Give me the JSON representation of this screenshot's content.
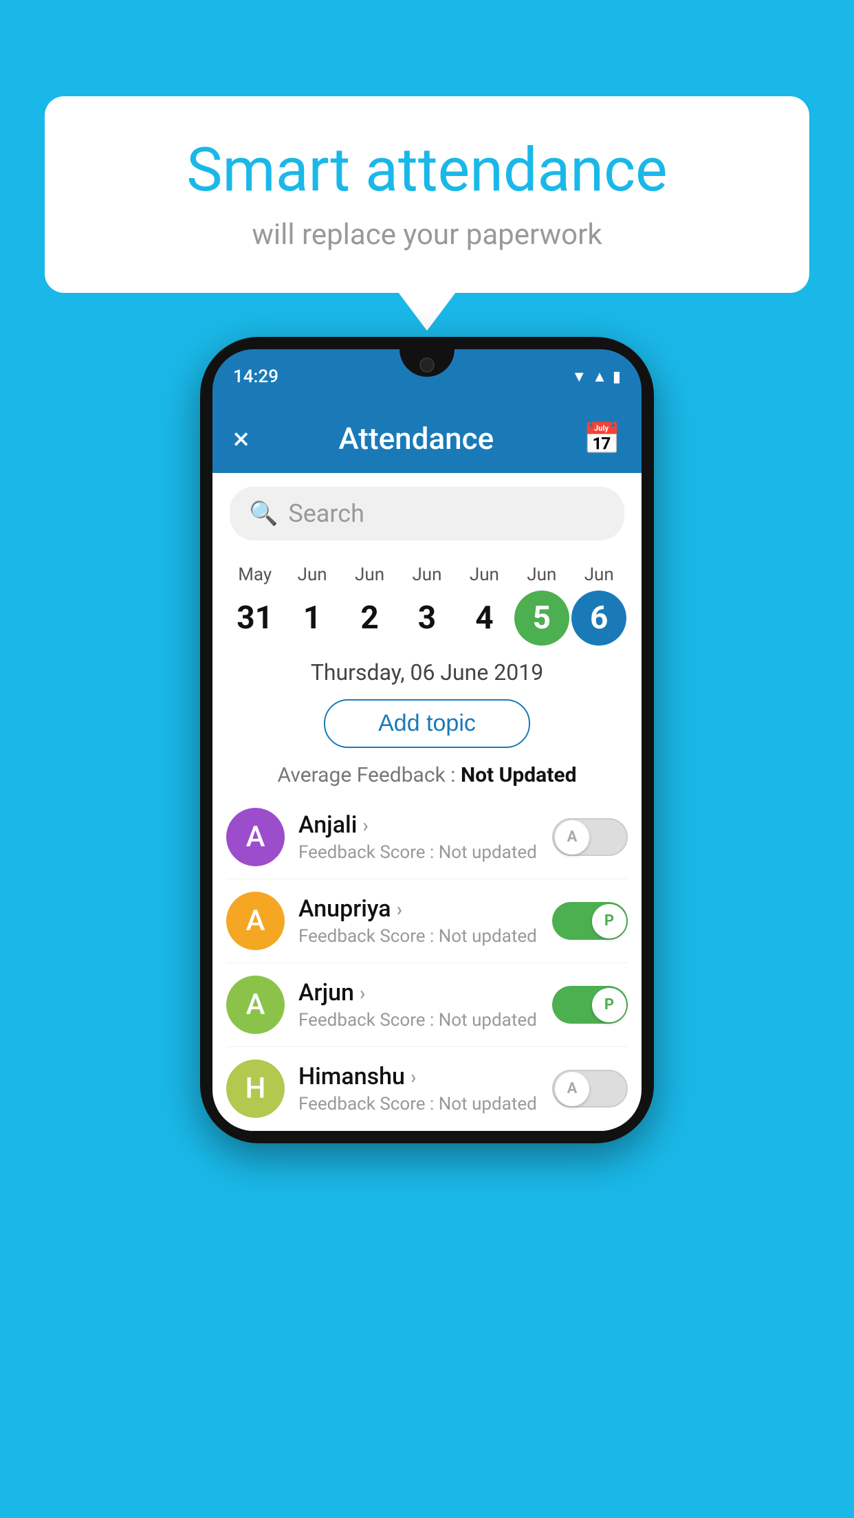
{
  "background": {
    "color": "#1ab8e8"
  },
  "speech_bubble": {
    "title": "Smart attendance",
    "subtitle": "will replace your paperwork"
  },
  "phone": {
    "status_bar": {
      "time": "14:29"
    },
    "app_bar": {
      "title": "Attendance",
      "close_label": "×",
      "calendar_label": "📅"
    },
    "search": {
      "placeholder": "Search"
    },
    "calendar": {
      "days": [
        {
          "month": "May",
          "num": "31",
          "state": "normal"
        },
        {
          "month": "Jun",
          "num": "1",
          "state": "normal"
        },
        {
          "month": "Jun",
          "num": "2",
          "state": "normal"
        },
        {
          "month": "Jun",
          "num": "3",
          "state": "normal"
        },
        {
          "month": "Jun",
          "num": "4",
          "state": "normal"
        },
        {
          "month": "Jun",
          "num": "5",
          "state": "today"
        },
        {
          "month": "Jun",
          "num": "6",
          "state": "selected"
        }
      ]
    },
    "selected_date": "Thursday, 06 June 2019",
    "add_topic_label": "Add topic",
    "avg_feedback_label": "Average Feedback : ",
    "avg_feedback_value": "Not Updated",
    "students": [
      {
        "name": "Anjali",
        "avatar_letter": "A",
        "avatar_color": "#9c4dcc",
        "feedback": "Feedback Score : Not updated",
        "toggle": "off",
        "toggle_letter": "A"
      },
      {
        "name": "Anupriya",
        "avatar_letter": "A",
        "avatar_color": "#f5a623",
        "feedback": "Feedback Score : Not updated",
        "toggle": "on",
        "toggle_letter": "P"
      },
      {
        "name": "Arjun",
        "avatar_letter": "A",
        "avatar_color": "#8bc34a",
        "feedback": "Feedback Score : Not updated",
        "toggle": "on",
        "toggle_letter": "P"
      },
      {
        "name": "Himanshu",
        "avatar_letter": "H",
        "avatar_color": "#b0c94e",
        "feedback": "Feedback Score : Not updated",
        "toggle": "off",
        "toggle_letter": "A"
      }
    ]
  }
}
